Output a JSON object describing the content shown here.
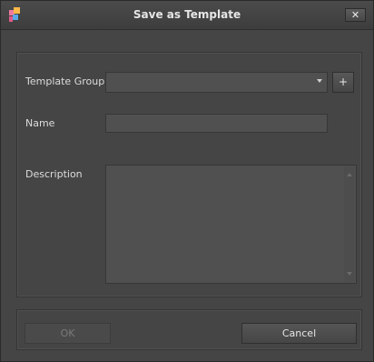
{
  "window": {
    "title": "Save as Template",
    "close_label": "✕"
  },
  "form": {
    "template_group_label": "Template Group",
    "template_group_value": "",
    "add_group_label": "+",
    "name_label": "Name",
    "name_value": "",
    "description_label": "Description",
    "description_value": ""
  },
  "buttons": {
    "ok_label": "OK",
    "cancel_label": "Cancel"
  },
  "icons": {
    "app": "template-app-icon",
    "dropdown": "chevron-down-icon",
    "scroll_up": "scroll-up-icon",
    "scroll_down": "scroll-down-icon"
  }
}
